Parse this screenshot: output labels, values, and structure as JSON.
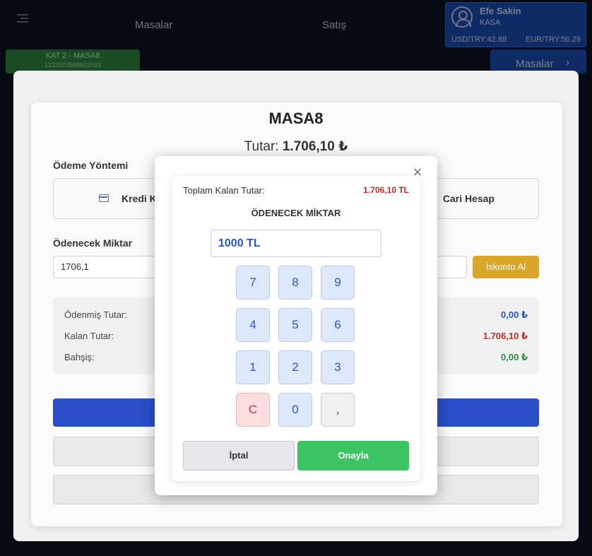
{
  "topbar": {
    "nav": [
      "Masalar",
      "Satış"
    ],
    "user": {
      "name": "Efe Sakin",
      "role": "KASA"
    },
    "rates": {
      "usd": "USD/TRY:42.88",
      "eur": "EUR/TRY:50.29"
    },
    "table_tab": {
      "label": "KAT 2 - MASA8",
      "sub": "1233203568602023"
    },
    "masalar_button": "Masalar"
  },
  "payment": {
    "title": "MASA8",
    "total_label": "Tutar:",
    "total_value": "1.706,10 ₺",
    "method_label": "Ödeme Yöntemi",
    "methods": [
      "Kredi Ka",
      "Cari Hesap"
    ],
    "amount_label": "Ödenecek Miktar",
    "amount_value": "1706,1",
    "discount_button": "İskonto Al",
    "summary": [
      {
        "label": "Ödenmiş Tutar:",
        "value": "0,00 ₺"
      },
      {
        "label": "Kalan Tutar:",
        "value": "1.706,10 ₺"
      },
      {
        "label": "Bahşiş:",
        "value": "0,00 ₺"
      }
    ]
  },
  "numpad": {
    "remaining_label": "Toplam Kalan Tutar:",
    "remaining_value": "1.706,10 TL",
    "title": "ÖDENECEK MİKTAR",
    "input_value": "1000 TL",
    "keys": [
      "7",
      "8",
      "9",
      "4",
      "5",
      "6",
      "1",
      "2",
      "3",
      "C",
      "0",
      ","
    ],
    "cancel": "İptal",
    "confirm": "Onayla",
    "close": "×"
  },
  "colors": {
    "accent_blue": "#2a4ec8",
    "confirm_green": "#3cc462",
    "danger_red": "#c62828",
    "discount_yellow": "#d9a62a"
  }
}
